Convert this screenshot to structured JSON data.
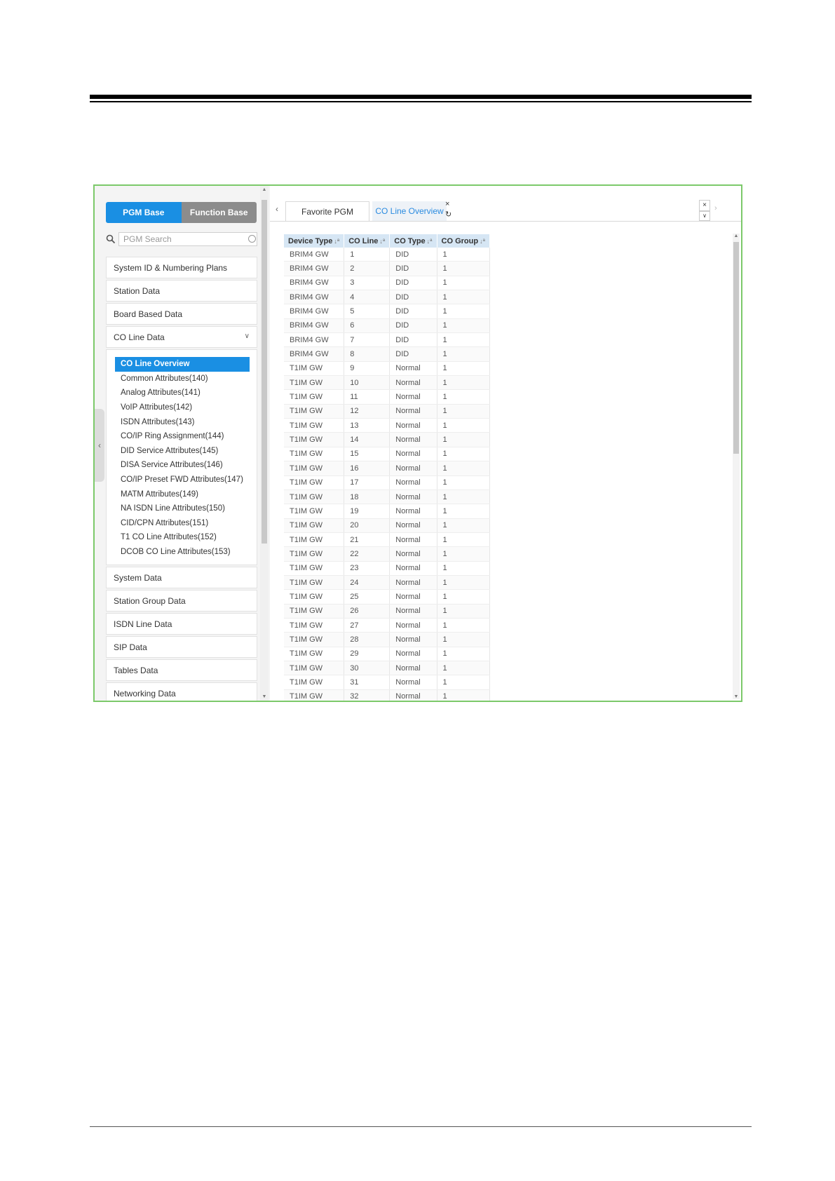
{
  "left_panel": {
    "segments": {
      "pgm_base": "PGM Base",
      "function_base": "Function Base"
    },
    "search": {
      "placeholder": "PGM Search"
    },
    "menu_top": [
      {
        "label": "System ID & Numbering Plans"
      },
      {
        "label": "Station Data"
      },
      {
        "label": "Board Based Data"
      },
      {
        "label": "CO Line Data"
      }
    ],
    "co_line_submenu": [
      {
        "label": "CO Line Overview"
      },
      {
        "label": "Common Attributes(140)"
      },
      {
        "label": "Analog Attributes(141)"
      },
      {
        "label": "VoIP Attributes(142)"
      },
      {
        "label": "ISDN Attributes(143)"
      },
      {
        "label": "CO/IP Ring Assignment(144)"
      },
      {
        "label": "DID Service Attributes(145)"
      },
      {
        "label": "DISA Service Attributes(146)"
      },
      {
        "label": "CO/IP Preset FWD Attributes(147)"
      },
      {
        "label": "MATM Attributes(149)"
      },
      {
        "label": "NA ISDN Line Attributes(150)"
      },
      {
        "label": "CID/CPN Attributes(151)"
      },
      {
        "label": "T1 CO Line Attributes(152)"
      },
      {
        "label": "DCOB CO Line Attributes(153)"
      }
    ],
    "menu_bottom": [
      {
        "label": "System Data"
      },
      {
        "label": "Station Group Data"
      },
      {
        "label": "ISDN Line Data"
      },
      {
        "label": "SIP Data"
      },
      {
        "label": "Tables Data"
      },
      {
        "label": "Networking Data"
      }
    ]
  },
  "tabs": {
    "favorite": "Favorite PGM",
    "co_overview": "CO Line Overview"
  },
  "table": {
    "headers": [
      "Device Type",
      "CO Line",
      "CO Type",
      "CO Group"
    ],
    "rows": [
      [
        "BRIM4 GW",
        "1",
        "DID",
        "1"
      ],
      [
        "BRIM4 GW",
        "2",
        "DID",
        "1"
      ],
      [
        "BRIM4 GW",
        "3",
        "DID",
        "1"
      ],
      [
        "BRIM4 GW",
        "4",
        "DID",
        "1"
      ],
      [
        "BRIM4 GW",
        "5",
        "DID",
        "1"
      ],
      [
        "BRIM4 GW",
        "6",
        "DID",
        "1"
      ],
      [
        "BRIM4 GW",
        "7",
        "DID",
        "1"
      ],
      [
        "BRIM4 GW",
        "8",
        "DID",
        "1"
      ],
      [
        "T1IM GW",
        "9",
        "Normal",
        "1"
      ],
      [
        "T1IM GW",
        "10",
        "Normal",
        "1"
      ],
      [
        "T1IM GW",
        "11",
        "Normal",
        "1"
      ],
      [
        "T1IM GW",
        "12",
        "Normal",
        "1"
      ],
      [
        "T1IM GW",
        "13",
        "Normal",
        "1"
      ],
      [
        "T1IM GW",
        "14",
        "Normal",
        "1"
      ],
      [
        "T1IM GW",
        "15",
        "Normal",
        "1"
      ],
      [
        "T1IM GW",
        "16",
        "Normal",
        "1"
      ],
      [
        "T1IM GW",
        "17",
        "Normal",
        "1"
      ],
      [
        "T1IM GW",
        "18",
        "Normal",
        "1"
      ],
      [
        "T1IM GW",
        "19",
        "Normal",
        "1"
      ],
      [
        "T1IM GW",
        "20",
        "Normal",
        "1"
      ],
      [
        "T1IM GW",
        "21",
        "Normal",
        "1"
      ],
      [
        "T1IM GW",
        "22",
        "Normal",
        "1"
      ],
      [
        "T1IM GW",
        "23",
        "Normal",
        "1"
      ],
      [
        "T1IM GW",
        "24",
        "Normal",
        "1"
      ],
      [
        "T1IM GW",
        "25",
        "Normal",
        "1"
      ],
      [
        "T1IM GW",
        "26",
        "Normal",
        "1"
      ],
      [
        "T1IM GW",
        "27",
        "Normal",
        "1"
      ],
      [
        "T1IM GW",
        "28",
        "Normal",
        "1"
      ],
      [
        "T1IM GW",
        "29",
        "Normal",
        "1"
      ],
      [
        "T1IM GW",
        "30",
        "Normal",
        "1"
      ],
      [
        "T1IM GW",
        "31",
        "Normal",
        "1"
      ],
      [
        "T1IM GW",
        "32",
        "Normal",
        "1"
      ]
    ]
  },
  "colors": {
    "accent": "#1a8fe3",
    "frame": "#7cc96a",
    "header_bg": "#d6e6f4",
    "segment_inactive": "#8c8c8c"
  }
}
